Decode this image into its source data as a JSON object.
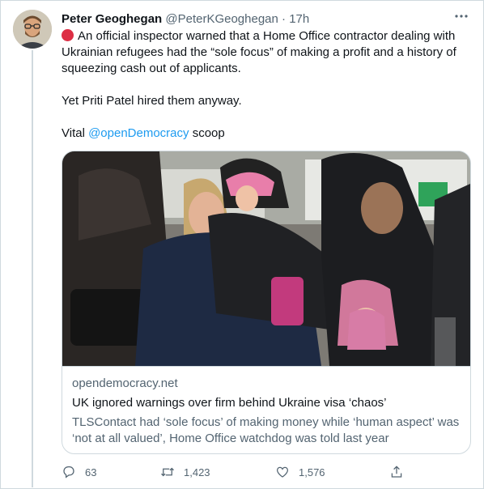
{
  "tweet": {
    "author_name": "Peter Geoghegan",
    "handle": "@PeterKGeoghegan",
    "separator": "·",
    "time": "17h",
    "more_icon": "more-dots-icon",
    "line1_text": "An official inspector warned that a Home Office contractor dealing with Ukrainian refugees had the “sole focus” of making a profit and a history of squeezing cash out of applicants.",
    "line2_text": "Yet Priti Patel hired them anyway.",
    "line3_prefix": "Vital ",
    "line3_mention": "@openDemocracy",
    "line3_suffix": " scoop",
    "emoji": "red-circle-emoji"
  },
  "card": {
    "domain": "opendemocracy.net",
    "title": "UK ignored warnings over firm behind Ukraine visa ‘chaos’",
    "description": "TLSContact had ‘sole focus’ of making money while ‘human aspect’ was ‘not at all valued’, Home Office watchdog was told last year"
  },
  "actions": {
    "reply_count": "63",
    "retweet_count": "1,423",
    "like_count": "1,576",
    "reply_icon": "reply-icon",
    "retweet_icon": "retweet-icon",
    "like_icon": "heart-icon",
    "share_icon": "share-icon"
  },
  "colors": {
    "link": "#1d9bf0",
    "secondary_text": "#536471",
    "border": "#cfd9de",
    "emoji_red": "#dd2e44"
  }
}
